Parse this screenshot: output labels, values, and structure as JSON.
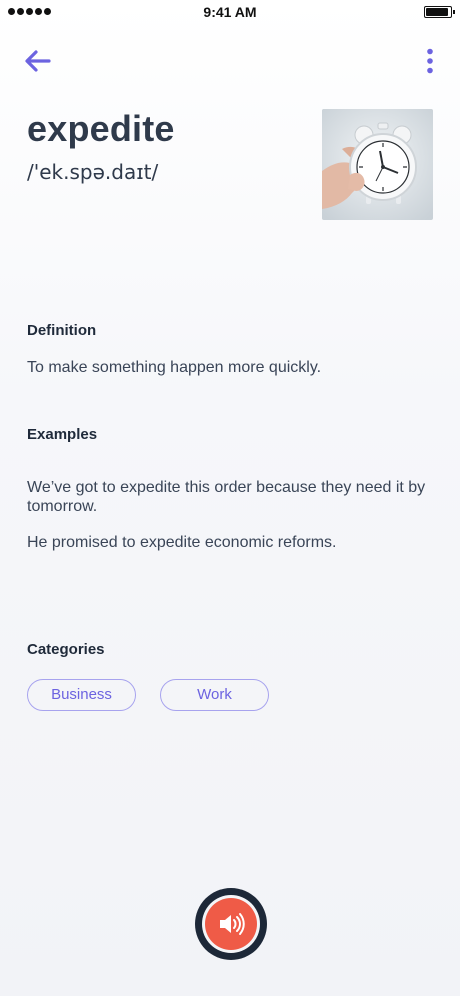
{
  "status_bar": {
    "time": "9:41 AM"
  },
  "word": {
    "title": "expedite",
    "phonetic": "/'ek.spə.daɪt/"
  },
  "definition": {
    "heading": "Definition",
    "text": "To make something happen more quickly."
  },
  "examples": {
    "heading": "Examples",
    "items": [
      "We’ve got to expedite this order because they need it by tomorrow.",
      "He promised to expedite economic reforms."
    ]
  },
  "categories": {
    "heading": "Categories",
    "items": [
      "Business",
      "Work"
    ]
  },
  "colors": {
    "accent": "#6c63e0",
    "audio_button": "#ef5b47",
    "text_dark": "#2f3a4b"
  },
  "icons": {
    "back": "arrow-left-icon",
    "more": "more-vertical-icon",
    "audio": "speaker-icon"
  }
}
